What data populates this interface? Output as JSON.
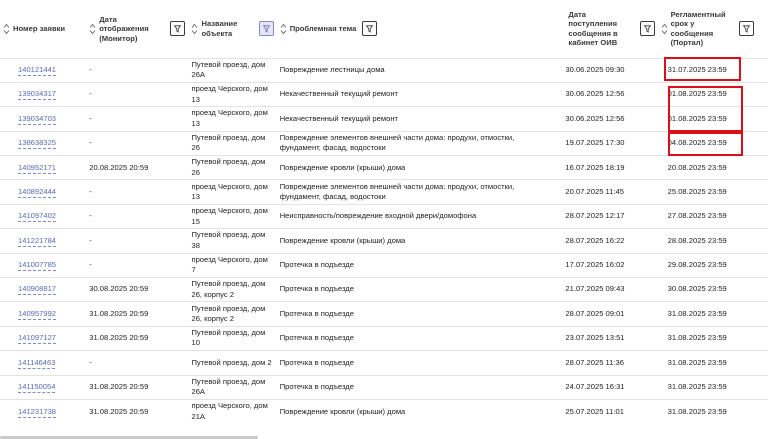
{
  "columns": [
    {
      "label": "Номер заявки",
      "filter": false,
      "sort": true
    },
    {
      "label": "Дата отображения (Монитор)",
      "filter": true,
      "sort": true
    },
    {
      "label": "Название объекта",
      "filter": true,
      "filter_active": true,
      "sort": true
    },
    {
      "label": "Проблемная тема",
      "filter": true,
      "sort": true
    },
    {
      "label": "Дата поступления сообщения в кабинет ОИВ",
      "filter": true,
      "sort": false
    },
    {
      "label": "Регламентный срок у сообщения (Портал)",
      "filter": true,
      "sort": true
    }
  ],
  "rows": [
    {
      "id": "140121441",
      "display": "-",
      "object": "Путевой проезд, дом 26А",
      "topic": "Повреждение лестницы дома",
      "received": "30.06.2025 09:30",
      "deadline": "31.07.2025 23:59"
    },
    {
      "id": "139034317",
      "display": "-",
      "object": "проезд Черского, дом 13",
      "topic": "Некачественный текущий ремонт",
      "received": "30.06.2025 12:56",
      "deadline": "01.08.2025 23:59"
    },
    {
      "id": "139034703",
      "display": "-",
      "object": "проезд Черского, дом 13",
      "topic": "Некачественный текущий ремонт",
      "received": "30.06.2025 12:56",
      "deadline": "01.08.2025 23:59"
    },
    {
      "id": "138638325",
      "display": "-",
      "object": "Путевой проезд, дом 26",
      "topic": "Повреждение элементов внешней части дома: продухи, отмостки, фундамент, фасад, водостоки",
      "received": "19.07.2025 17:30",
      "deadline": "04.08.2025 23:59"
    },
    {
      "id": "140952171",
      "display": "20.08.2025 20:59",
      "object": "Путевой проезд, дом 26",
      "topic": "Повреждение кровли (крыши) дома",
      "received": "16.07.2025 18:19",
      "deadline": "20.08.2025 23:59"
    },
    {
      "id": "140892444",
      "display": "-",
      "object": "проезд Черского, дом 13",
      "topic": "Повреждение элементов внешней части дома: продухи, отмостки, фундамент, фасад, водостоки",
      "received": "20.07.2025 11:45",
      "deadline": "25.08.2025 23:59"
    },
    {
      "id": "141097402",
      "display": "-",
      "object": "проезд Черского, дом 15",
      "topic": "Неисправность/повреждение входной двери/домофона",
      "received": "28.07.2025 12:17",
      "deadline": "27.08.2025 23:59"
    },
    {
      "id": "141221784",
      "display": "-",
      "object": "Путевой проезд, дом 38",
      "topic": "Повреждение кровли (крыши) дома",
      "received": "28.07.2025 16:22",
      "deadline": "28.08.2025 23:59"
    },
    {
      "id": "141007785",
      "display": "-",
      "object": "проезд Черского, дом 7",
      "topic": "Протечка в подъезде",
      "received": "17.07.2025 16:02",
      "deadline": "29.08.2025 23:59"
    },
    {
      "id": "140908817",
      "display": "30.08.2025 20:59",
      "object": "Путевой проезд, дом 26, корпус 2",
      "topic": "Протечка в подъезде",
      "received": "21.07.2025 09:43",
      "deadline": "30.08.2025 23:59"
    },
    {
      "id": "140957992",
      "display": "31.08.2025 20:59",
      "object": "Путевой проезд, дом 26, корпус 2",
      "topic": "Протечка в подъезде",
      "received": "28.07.2025 09:01",
      "deadline": "31.08.2025 23:59"
    },
    {
      "id": "141097127",
      "display": "31.08.2025 20:59",
      "object": "Путевой проезд, дом 10",
      "topic": "Протечка в подъезде",
      "received": "23.07.2025 13:51",
      "deadline": "31.08.2025 23:59"
    },
    {
      "id": "141146463",
      "display": "-",
      "object": "Путевой проезд, дом 2",
      "topic": "Протечка в подъезде",
      "received": "28.07.2025 11:36",
      "deadline": "31.08.2025 23:59"
    },
    {
      "id": "141150054",
      "display": "31.08.2025 20:59",
      "object": "Путевой проезд, дом 26А",
      "topic": "Протечка в подъезде",
      "received": "24.07.2025 16:31",
      "deadline": "31.08.2025 23:59"
    },
    {
      "id": "141231738",
      "display": "31.08.2025 20:59",
      "object": "проезд Черского, дом 21А",
      "topic": "Повреждение кровли (крыши) дома",
      "received": "25.07.2025 11:01",
      "deadline": "31.08.2025 23:59"
    }
  ],
  "highlight_color": "#d9101a"
}
